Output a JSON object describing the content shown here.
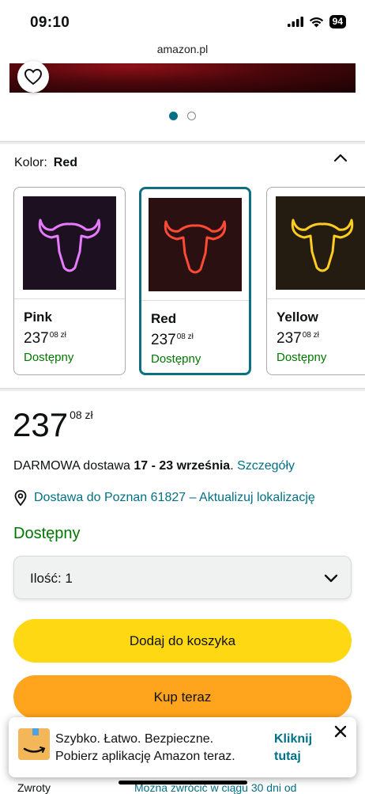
{
  "status_bar": {
    "time": "09:10",
    "battery": "94"
  },
  "browser": {
    "url": "amazon.pl"
  },
  "variation": {
    "label": "Kolor:",
    "selected": "Red"
  },
  "swatches": [
    {
      "name": "Pink",
      "price_whole": "237",
      "price_fraction": "08 zł",
      "availability": "Dostępny",
      "color": "#d84cf0"
    },
    {
      "name": "Red",
      "price_whole": "237",
      "price_fraction": "08 zł",
      "availability": "Dostępny",
      "color": "#ff3b2a"
    },
    {
      "name": "Yellow",
      "price_whole": "237",
      "price_fraction": "08 zł",
      "availability": "Dostępny",
      "color": "#ffc51a"
    }
  ],
  "price": {
    "whole": "237",
    "fraction": "08 zł"
  },
  "delivery": {
    "prefix": "DARMOWA dostawa ",
    "dates": "17 - 23 września",
    "suffix": ". ",
    "details_link": "Szczegóły"
  },
  "location": {
    "text": "Dostawa do Poznan 61827 – Aktualizuj lokalizację"
  },
  "availability": "Dostępny",
  "quantity": {
    "label": "Ilość:",
    "value": "1"
  },
  "buttons": {
    "add_to_cart": "Dodaj do koszyka",
    "buy_now": "Kup teraz"
  },
  "app_banner": {
    "line1": "Szybko. Łatwo. Bezpieczne.",
    "line2": "Pobierz aplikację Amazon teraz.",
    "cta_line1": "Kliknij",
    "cta_line2": "tutaj"
  },
  "bottom_partial": {
    "left": "Zwroty",
    "right": "Można zwrócić w ciągu 30 dni od"
  },
  "colors": {
    "link": "#007185",
    "available": "#007600",
    "cart": "#ffd814",
    "buy": "#ffa41c",
    "selected_border": "#0f6f80"
  }
}
